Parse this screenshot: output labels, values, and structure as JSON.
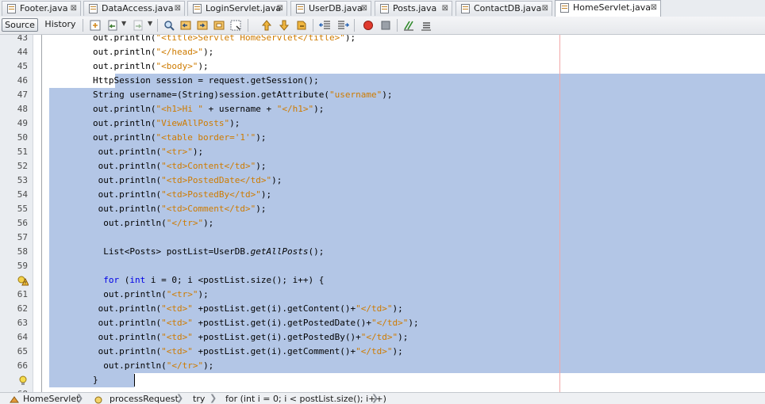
{
  "tabs": [
    {
      "label": "Footer.java",
      "icon": "java-file-icon",
      "active": false
    },
    {
      "label": "DataAccess.java",
      "icon": "java-file-icon",
      "active": false
    },
    {
      "label": "LoginServlet.java",
      "icon": "java-file-icon",
      "active": false
    },
    {
      "label": "UserDB.java",
      "icon": "java-file-icon",
      "active": false
    },
    {
      "label": "Posts.java",
      "icon": "java-file-icon",
      "active": false
    },
    {
      "label": "ContactDB.java",
      "icon": "java-file-icon",
      "active": false
    },
    {
      "label": "HomeServlet.java",
      "icon": "java-file-icon",
      "active": true
    }
  ],
  "toolbar": {
    "source_label": "Source",
    "history_label": "History"
  },
  "editor": {
    "lines": [
      {
        "num": "43",
        "gutter_icon": ""
      },
      {
        "num": "44",
        "gutter_icon": ""
      },
      {
        "num": "45",
        "gutter_icon": ""
      },
      {
        "num": "46",
        "gutter_icon": ""
      },
      {
        "num": "47",
        "gutter_icon": ""
      },
      {
        "num": "48",
        "gutter_icon": ""
      },
      {
        "num": "49",
        "gutter_icon": ""
      },
      {
        "num": "50",
        "gutter_icon": ""
      },
      {
        "num": "51",
        "gutter_icon": ""
      },
      {
        "num": "52",
        "gutter_icon": ""
      },
      {
        "num": "53",
        "gutter_icon": ""
      },
      {
        "num": "54",
        "gutter_icon": ""
      },
      {
        "num": "55",
        "gutter_icon": ""
      },
      {
        "num": "56",
        "gutter_icon": ""
      },
      {
        "num": "57",
        "gutter_icon": ""
      },
      {
        "num": "58",
        "gutter_icon": ""
      },
      {
        "num": "59",
        "gutter_icon": ""
      },
      {
        "num": "",
        "gutter_icon": "warning-icon"
      },
      {
        "num": "61",
        "gutter_icon": ""
      },
      {
        "num": "62",
        "gutter_icon": ""
      },
      {
        "num": "63",
        "gutter_icon": ""
      },
      {
        "num": "64",
        "gutter_icon": ""
      },
      {
        "num": "65",
        "gutter_icon": ""
      },
      {
        "num": "66",
        "gutter_icon": ""
      },
      {
        "num": "",
        "gutter_icon": "hint-bulb-icon"
      },
      {
        "num": "68",
        "gutter_icon": ""
      }
    ],
    "code": [
      [
        {
          "t": "        out.println("
        },
        {
          "t": "\"<title>Servlet HomeServlet</title>\"",
          "c": "s"
        },
        {
          "t": ");"
        }
      ],
      [
        {
          "t": "        out.println("
        },
        {
          "t": "\"</head>\"",
          "c": "s"
        },
        {
          "t": ");"
        }
      ],
      [
        {
          "t": "        out.println("
        },
        {
          "t": "\"<body>\"",
          "c": "s"
        },
        {
          "t": ");"
        }
      ],
      [
        {
          "t": "        HttpSession session = request.getSession();"
        }
      ],
      [
        {
          "t": "        String username=(String)session.getAttribute("
        },
        {
          "t": "\"username\"",
          "c": "s"
        },
        {
          "t": ");"
        }
      ],
      [
        {
          "t": "        out.println("
        },
        {
          "t": "\"<h1>Hi \"",
          "c": "s"
        },
        {
          "t": " + username + "
        },
        {
          "t": "\"</h1>\"",
          "c": "s"
        },
        {
          "t": ");"
        }
      ],
      [
        {
          "t": "        out.println("
        },
        {
          "t": "\"ViewAllPosts\"",
          "c": "s"
        },
        {
          "t": ");"
        }
      ],
      [
        {
          "t": "        out.println("
        },
        {
          "t": "\"<table border='1'\"",
          "c": "s"
        },
        {
          "t": ");"
        }
      ],
      [
        {
          "t": "         out.println("
        },
        {
          "t": "\"<tr>\"",
          "c": "s"
        },
        {
          "t": ");"
        }
      ],
      [
        {
          "t": "         out.println("
        },
        {
          "t": "\"<td>Content</td>\"",
          "c": "s"
        },
        {
          "t": ");"
        }
      ],
      [
        {
          "t": "         out.println("
        },
        {
          "t": "\"<td>PostedDate</td>\"",
          "c": "s"
        },
        {
          "t": ");"
        }
      ],
      [
        {
          "t": "         out.println("
        },
        {
          "t": "\"<td>PostedBy</td>\"",
          "c": "s"
        },
        {
          "t": ");"
        }
      ],
      [
        {
          "t": "         out.println("
        },
        {
          "t": "\"<td>Comment</td>\"",
          "c": "s"
        },
        {
          "t": ");"
        }
      ],
      [
        {
          "t": "          out.println("
        },
        {
          "t": "\"</tr>\"",
          "c": "s"
        },
        {
          "t": ");"
        }
      ],
      [],
      [
        {
          "t": "          List<Posts> postList=UserDB."
        },
        {
          "t": "getAllPosts",
          "c": "i"
        },
        {
          "t": "();"
        }
      ],
      [],
      [
        {
          "t": "          "
        },
        {
          "t": "for",
          "c": "k"
        },
        {
          "t": " ("
        },
        {
          "t": "int",
          "c": "k"
        },
        {
          "t": " i = 0; i <postList.size(); i++) {"
        }
      ],
      [
        {
          "t": "          out.println("
        },
        {
          "t": "\"<tr>\"",
          "c": "s"
        },
        {
          "t": ");"
        }
      ],
      [
        {
          "t": "         out.println("
        },
        {
          "t": "\"<td>\"",
          "c": "s"
        },
        {
          "t": " +postList.get(i).getContent()+"
        },
        {
          "t": "\"</td>\"",
          "c": "s"
        },
        {
          "t": ");"
        }
      ],
      [
        {
          "t": "         out.println("
        },
        {
          "t": "\"<td>\"",
          "c": "s"
        },
        {
          "t": " +postList.get(i).getPostedDate()+"
        },
        {
          "t": "\"</td>\"",
          "c": "s"
        },
        {
          "t": ");"
        }
      ],
      [
        {
          "t": "         out.println("
        },
        {
          "t": "\"<td>\"",
          "c": "s"
        },
        {
          "t": " +postList.get(i).getPostedBy()+"
        },
        {
          "t": "\"</td>\"",
          "c": "s"
        },
        {
          "t": ");"
        }
      ],
      [
        {
          "t": "         out.println("
        },
        {
          "t": "\"<td>\"",
          "c": "s"
        },
        {
          "t": " +postList.get(i).getComment()+"
        },
        {
          "t": "\"</td>\"",
          "c": "s"
        },
        {
          "t": ");"
        }
      ],
      [
        {
          "t": "          out.println("
        },
        {
          "t": "\"</tr>\"",
          "c": "s"
        },
        {
          "t": ");"
        }
      ],
      [
        {
          "t": "        }"
        }
      ],
      []
    ]
  },
  "breadcrumbs": [
    {
      "label": "HomeServlet",
      "icon": "class-icon"
    },
    {
      "label": "processRequest",
      "icon": "method-icon"
    },
    {
      "label": "try",
      "icon": ""
    },
    {
      "label": "for (int i = 0; i < postList.size(); i++)",
      "icon": ""
    }
  ],
  "colors": {
    "selection": "#b3c6e6",
    "string": "#ce7b00",
    "keyword": "#0000e6",
    "margin_line": "#f3a8a8"
  }
}
